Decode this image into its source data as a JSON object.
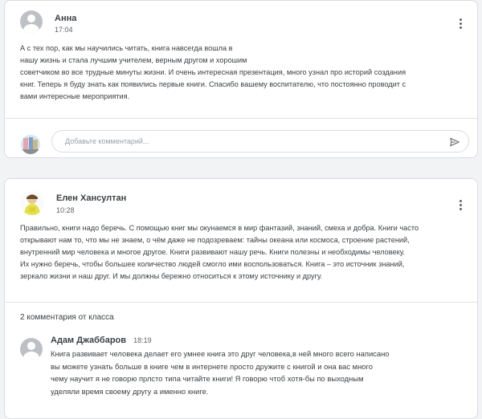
{
  "posts": [
    {
      "author": "Анна",
      "time": "17:04",
      "text": "А с тех пор, как мы научились читать, книга навсегда вошла в\nнашу жизнь и стала лучшим учителем, верным другом и хорошим\nсоветчиком во все трудные минуты жизни.  И очень интересная  презентация, много узнал про историй создания\nкниг.  Теперь я буду знать как появились первые книги. Спасибо вашему воспитателю, что постоянно проводит с\nвами интересные мероприятия.",
      "comment_placeholder": "Добавьте комментарий..."
    },
    {
      "author": "Елен Хансултан",
      "time": "10:28",
      "text": "Правильно, книги надо беречь. С помощью книг мы окунаемся в мир фантазий, знаний, смеха и добра. Книги часто\nоткрывают нам то, что мы не знаем, о чём даже не подозреваем: тайны океана или космоса, строение растений,\nвнутренний мир человека и многое другое. Книги развивают нашу речь. Книги полезны и необходимы человеку.\nИх нужно беречь, чтобы большее количество людей смогло ими воспользоваться. Книга – это источник знаний,\nзеркало жизни и наш друг. И мы должны бережно относиться к этому источнику и другу.",
      "class_comments_title": "2 комментария от класса",
      "comment": {
        "author": "Адам Джаббаров",
        "time": "18:19",
        "text": "Книга развивает человека делает его умнее книга это друг человека,в ней много всего написано\nвы можете узнать больше в книге чем в интернете просто дружите с книгой и она вас много\nчему научит я не говорю прлсто типа читайте книги! Я говорю чтоб хотя-бы по выходным\nуделяли время своему другу а именно книге."
      }
    }
  ],
  "icons": {
    "more": "more-vert-icon",
    "send": "send-icon",
    "avatar": "account-circle-icon"
  },
  "colors": {
    "background": "#f1f3f4",
    "card": "#ffffff",
    "border": "#dadce0",
    "text": "#3c4043",
    "muted": "#5f6368",
    "avatar_gray": "#bdc1c6"
  }
}
